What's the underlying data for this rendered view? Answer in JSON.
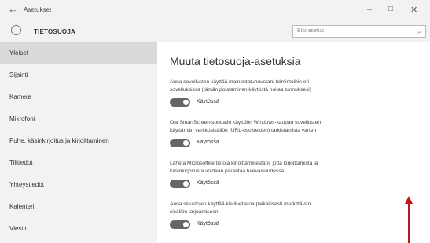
{
  "window": {
    "back_glyph": "←",
    "app_title": "Asetukset",
    "min_glyph": "–",
    "max_glyph": "□",
    "close_glyph": "✕"
  },
  "header": {
    "section_title": "TIETOSUOJA",
    "search_placeholder": "Etsi asetus",
    "search_icon": "search-icon"
  },
  "sidebar": {
    "items": [
      {
        "label": "Yleiset",
        "selected": true
      },
      {
        "label": "Sijainti"
      },
      {
        "label": "Kamera"
      },
      {
        "label": "Mikrofoni"
      },
      {
        "label": "Puhe, käsinkirjoitus ja kirjoittaminen"
      },
      {
        "label": "Tilitiedot"
      },
      {
        "label": "Yhteystiedot"
      },
      {
        "label": "Kalenteri"
      },
      {
        "label": "Viestit"
      }
    ]
  },
  "main": {
    "heading": "Muuta tietosuoja-asetuksia",
    "settings": [
      {
        "line1": "Anna sovellusten käyttää mainontatunnustani toimintoihin eri",
        "line2": "sovelluksissa (tämän poistaminen käytöstä nollaa tunnuksesi)",
        "state": "Käytössä"
      },
      {
        "line1": "Ota SmartScreen-suodatin käyttöön Windows-kaupan sovellusten",
        "line2": "käyttämän verkkosisällön (URL-osoitteiden) tarkistamista varten",
        "state": "Käytössä"
      },
      {
        "line1": "Lähetä Microsoftille tietoja kirjoittamisestani, jotta kirjoittamista ja",
        "line2": "käsinkirjoitusta voidaan parantaa tulevaisuudessa",
        "state": "Käytössä"
      },
      {
        "line1": "Anna sivustojen käyttää kieliluetteloa paikallisesti merkittävän",
        "line2": "sisällön tarjoamiseen",
        "state": "Käytössä"
      }
    ]
  },
  "colors": {
    "toggle_on": "#666666",
    "annotation_arrow": "#c0151b",
    "selected_item": "#d9d9d9"
  }
}
